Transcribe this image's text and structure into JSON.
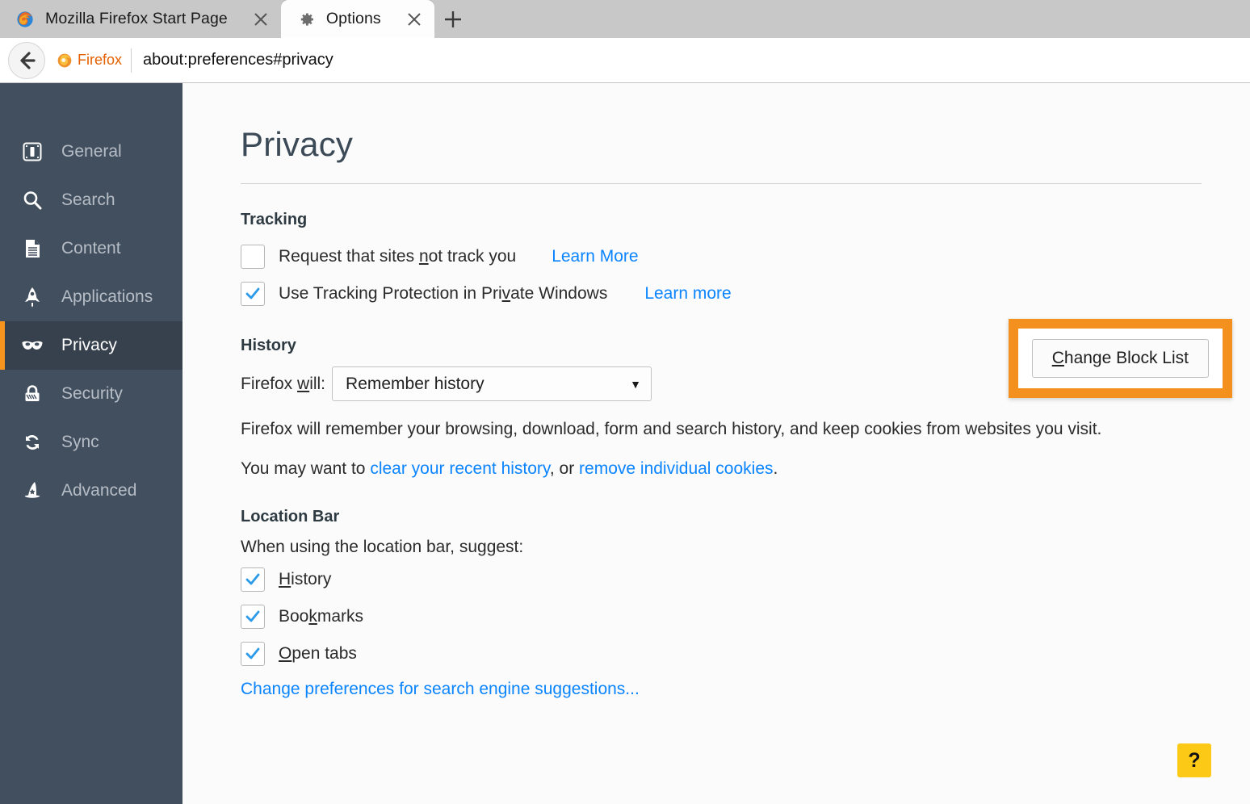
{
  "browser": {
    "tabs": [
      {
        "title": "Mozilla Firefox Start Page",
        "icon": "firefox-logo-icon",
        "active": false,
        "close_icon": "close-icon"
      },
      {
        "title": "Options",
        "icon": "gear-icon",
        "active": true,
        "close_icon": "close-icon"
      }
    ],
    "new_tab_icon": "plus-icon",
    "back_icon": "back-arrow-icon",
    "identity_icon": "firefox-logo-icon",
    "identity_label": "Firefox",
    "url": "about:preferences#privacy"
  },
  "sidebar": {
    "items": [
      {
        "label": "General",
        "icon": "preferences-general-icon",
        "selected": false
      },
      {
        "label": "Search",
        "icon": "search-icon",
        "selected": false
      },
      {
        "label": "Content",
        "icon": "document-icon",
        "selected": false
      },
      {
        "label": "Applications",
        "icon": "rocket-icon",
        "selected": false
      },
      {
        "label": "Privacy",
        "icon": "mask-icon",
        "selected": true
      },
      {
        "label": "Security",
        "icon": "padlock-icon",
        "selected": false
      },
      {
        "label": "Sync",
        "icon": "sync-arrows-icon",
        "selected": false
      },
      {
        "label": "Advanced",
        "icon": "wizard-hat-icon",
        "selected": false
      }
    ],
    "accent_color": "#f7941e",
    "background_color": "#424f5e",
    "selected_background_color": "#37414e"
  },
  "main": {
    "page_title": "Privacy",
    "tracking": {
      "heading": "Tracking",
      "dnt": {
        "label_pre": "Request that sites ",
        "label_key": "n",
        "label_post": "ot track you",
        "checked": false,
        "link": "Learn More"
      },
      "tracking_protection": {
        "label_pre": "Use Tracking Protection in Pri",
        "label_key": "v",
        "label_post": "ate Windows",
        "checked": true,
        "link": "Learn more"
      },
      "change_block_list_pre": "",
      "change_block_list_key": "C",
      "change_block_list_post": "hange Block List",
      "highlight_color": "#f4901e"
    },
    "history": {
      "heading": "History",
      "will_label_pre": "Firefox ",
      "will_label_key": "w",
      "will_label_post": "ill:",
      "dropdown_value": "Remember history",
      "dropdown_caret_icon": "chevron-down-icon",
      "description": "Firefox will remember your browsing, download, form and search history, and keep cookies from websites you visit.",
      "suggestion_pre": "You may want to ",
      "suggestion_link_1": "clear your recent history",
      "suggestion_mid": ", or ",
      "suggestion_link_2": "remove individual cookies",
      "suggestion_post": "."
    },
    "location_bar": {
      "heading": "Location Bar",
      "sub_label": "When using the location bar, suggest:",
      "options": [
        {
          "pre": "",
          "key": "H",
          "post": "istory",
          "checked": true
        },
        {
          "pre": "Boo",
          "key": "k",
          "post": "marks",
          "checked": true
        },
        {
          "pre": "",
          "key": "O",
          "post": "pen tabs",
          "checked": true
        }
      ],
      "search_prefs_link": "Change preferences for search engine suggestions..."
    },
    "help_button_label": "?",
    "help_button_color": "#fcc917"
  }
}
